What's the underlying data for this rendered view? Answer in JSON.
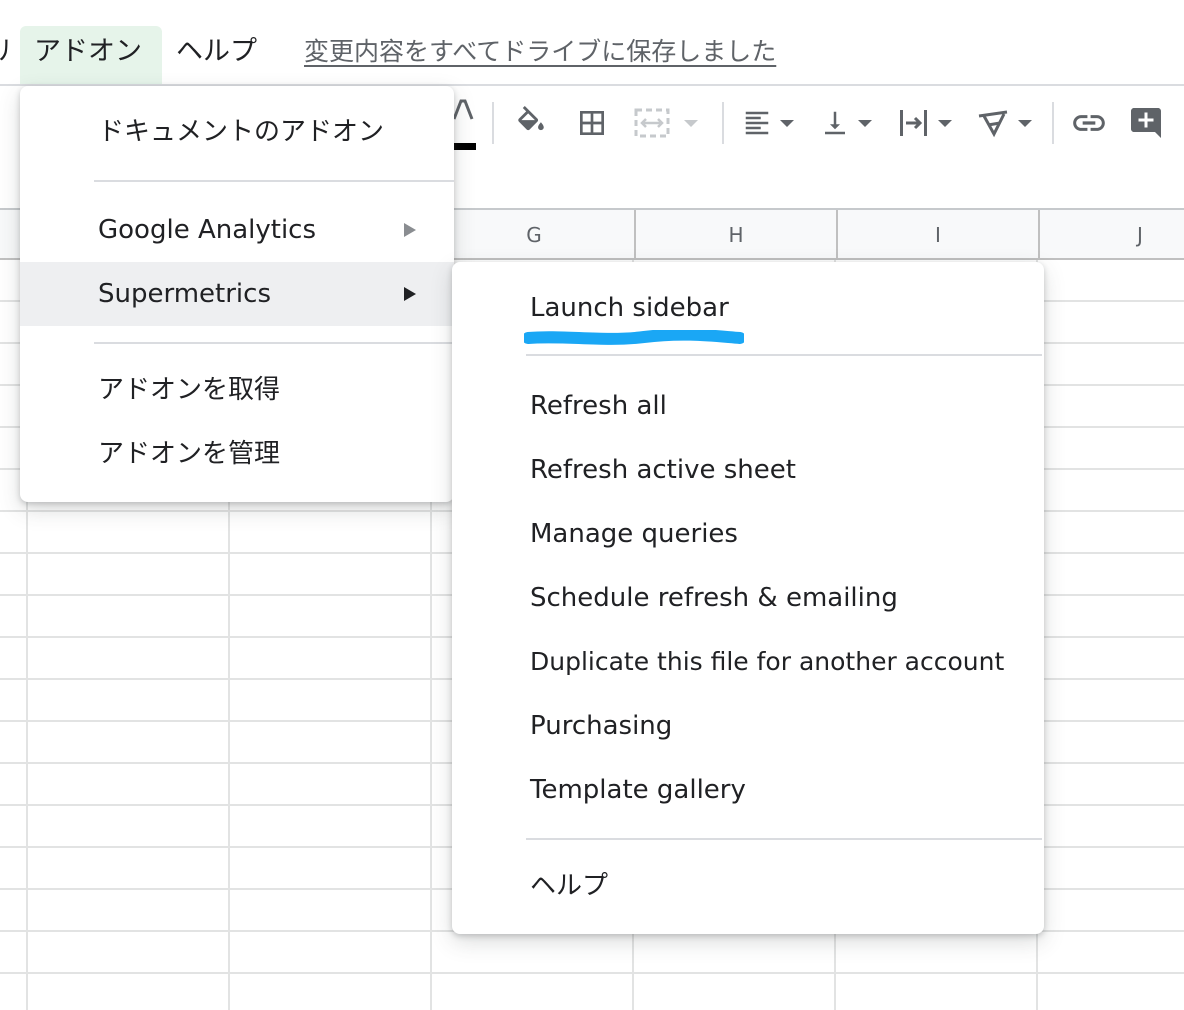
{
  "menubar": {
    "partial_item": "ル",
    "addons": "アドオン",
    "help": "ヘルプ",
    "save_status": "変更内容をすべてドライブに保存しました"
  },
  "toolbar": {
    "icons": [
      "text-color-icon",
      "fill-color-icon",
      "borders-icon",
      "merge-cells-icon",
      "horizontal-align-icon",
      "vertical-align-icon",
      "text-wrapping-icon",
      "text-rotation-icon",
      "insert-link-icon",
      "insert-comment-icon"
    ]
  },
  "columns": [
    "G",
    "H",
    "I",
    "J"
  ],
  "addons_menu": {
    "items": [
      {
        "label": "ドキュメントのアドオン"
      },
      {
        "label": "Google Analytics",
        "has_submenu": true
      },
      {
        "label": "Supermetrics",
        "has_submenu": true,
        "highlighted": true
      },
      {
        "label": "アドオンを取得"
      },
      {
        "label": "アドオンを管理"
      }
    ]
  },
  "supermetrics_menu": {
    "items": [
      {
        "label": "Launch sidebar",
        "annotated": true
      },
      {
        "label": "Refresh all"
      },
      {
        "label": "Refresh active sheet"
      },
      {
        "label": "Manage queries"
      },
      {
        "label": "Schedule refresh & emailing"
      },
      {
        "label": "Duplicate this file for another account"
      },
      {
        "label": "Purchasing"
      },
      {
        "label": "Template gallery"
      },
      {
        "label": "ヘルプ"
      }
    ],
    "annotation_color": "#1aa7f5"
  },
  "colors": {
    "accent_menu_bg": "#e6f4ea",
    "highlight_row": "#eeeff1",
    "icon": "#5f6368"
  }
}
